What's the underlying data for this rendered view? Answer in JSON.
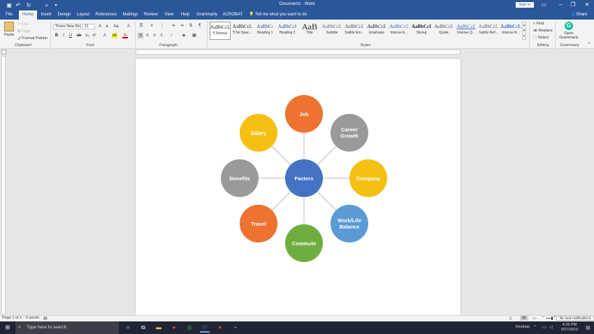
{
  "window": {
    "doc_title": "Document1 - Word",
    "signin": "Sign in"
  },
  "tabs": [
    {
      "label": "File"
    },
    {
      "label": "Home"
    },
    {
      "label": "Insert"
    },
    {
      "label": "Design"
    },
    {
      "label": "Layout"
    },
    {
      "label": "References"
    },
    {
      "label": "Mailings"
    },
    {
      "label": "Review"
    },
    {
      "label": "View"
    },
    {
      "label": "Help"
    },
    {
      "label": "Grammarly"
    },
    {
      "label": "ACROBAT"
    }
  ],
  "tell_me": "Tell me what you want to do",
  "share": "Share",
  "clipboard": {
    "paste": "Paste",
    "cut": "Cut",
    "copy": "Copy",
    "format_painter": "Format Painter",
    "label": "Clipboard"
  },
  "font": {
    "name": "Times New Ro",
    "size": "11",
    "label": "Font"
  },
  "paragraph": {
    "label": "Paragraph"
  },
  "styles": {
    "label": "Styles",
    "items": [
      {
        "preview": "AaBbCcL",
        "name": "¶ Normal"
      },
      {
        "preview": "AaBbCcL",
        "name": "¶ No Spac..."
      },
      {
        "preview": "AaBbCı",
        "name": "Heading 1"
      },
      {
        "preview": "AaBbCcI",
        "name": "Heading 2"
      },
      {
        "preview": "AaB",
        "name": "Title"
      },
      {
        "preview": "AaBbCcL",
        "name": "Subtitle"
      },
      {
        "preview": "AaBbCcL",
        "name": "Subtle Em..."
      },
      {
        "preview": "AaBbCcL",
        "name": "Emphasis"
      },
      {
        "preview": "AaBbCcL",
        "name": "Intense E..."
      },
      {
        "preview": "AaBbCcI",
        "name": "Strong"
      },
      {
        "preview": "AaBbCcL",
        "name": "Quote"
      },
      {
        "preview": "AaBbCcL",
        "name": "Intense Q..."
      },
      {
        "preview": "AaBbCcL",
        "name": "Subtle Ref..."
      },
      {
        "preview": "AaBbCcL",
        "name": "Intense R..."
      }
    ]
  },
  "editing": {
    "find": "Find",
    "replace": "Replace",
    "select": "Select",
    "label": "Editing"
  },
  "grammarly": {
    "open": "Open",
    "open2": "Grammarly",
    "label": "Grammarly"
  },
  "diagram": {
    "center": "Factors",
    "nodes": [
      {
        "label": "Job",
        "color": "#ee7230"
      },
      {
        "label": "Career Growth",
        "color": "#9a9a9a"
      },
      {
        "label": "Company",
        "color": "#f5c012"
      },
      {
        "label": "Work/Life Balance",
        "color": "#5b9bd5"
      },
      {
        "label": "Commute",
        "color": "#6eae3f"
      },
      {
        "label": "Travel",
        "color": "#ee7230"
      },
      {
        "label": "Benefits",
        "color": "#9a9a9a"
      },
      {
        "label": "Salary",
        "color": "#f5c012"
      }
    ],
    "center_color": "#4472c4"
  },
  "status": {
    "page": "Page 1 of 1",
    "words": "0 words",
    "zoom_minus": "−",
    "zoom_plus": "+"
  },
  "taskbar": {
    "search": "Type here to search",
    "desktop": "Desktop",
    "time": "4:26 PM",
    "date": "9/27/2019",
    "notifications": "No new notifications"
  },
  "colors": {
    "word_blue": "#2b579a"
  }
}
